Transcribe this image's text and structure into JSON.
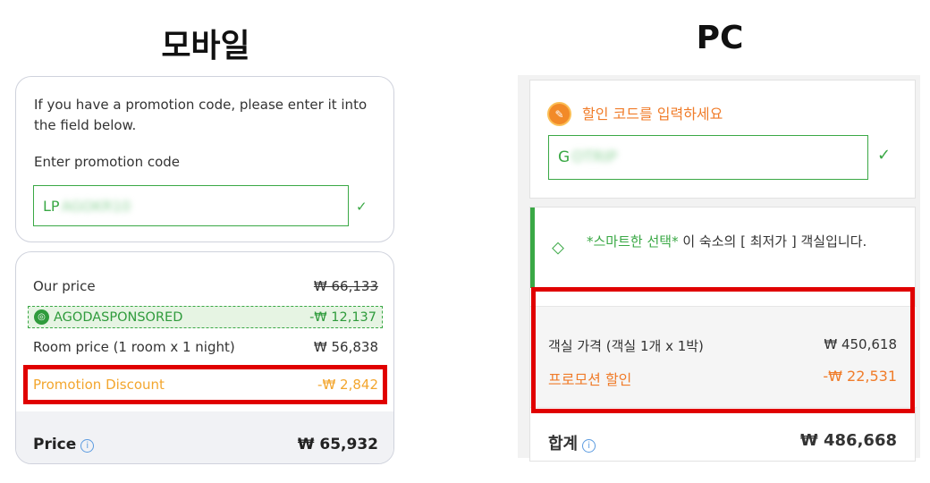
{
  "headings": {
    "mobile": "모바일",
    "pc": "PC"
  },
  "mobile": {
    "promo_instructions": "If you have a promotion code, please enter it into the field below.",
    "promo_label": "Enter promotion code",
    "promo_code_prefix": "LP",
    "promo_code_blurred": "AGOKR10",
    "check_icon": "✓",
    "rows": {
      "our_price_label": "Our price",
      "our_price_value": "₩ 66,133",
      "sponsored_label": "AGODASPONSORED",
      "sponsored_value": "-₩ 12,137",
      "room_price_label": "Room price (1 room x 1 night)",
      "room_price_value": "₩ 56,838",
      "promo_discount_label": "Promotion Discount",
      "promo_discount_value": "-₩ 2,842"
    },
    "total_label": "Price",
    "total_value": "₩ 65,932",
    "info_icon": "i"
  },
  "pc": {
    "promo_prompt": "할인 코드를 입력하세요",
    "promo_code_prefix": "G",
    "promo_code_blurred": "OTRIP",
    "check_icon": "✓",
    "smart_highlight": "*스마트한 선택*",
    "smart_text": " 이 숙소의 [ 최저가 ] 객실입니다.",
    "room_price_label": "객실 가격 (객실 1개 x 1박)",
    "room_price_value": "₩ 450,618",
    "promo_discount_label": "프로모션 할인",
    "promo_discount_value": "-₩ 22,531",
    "total_label": "합계",
    "total_value": "₩ 486,668",
    "info_icon": "i"
  },
  "colors": {
    "highlight": "#e00000",
    "green": "#3aa845",
    "orange": "#f07c2a"
  }
}
